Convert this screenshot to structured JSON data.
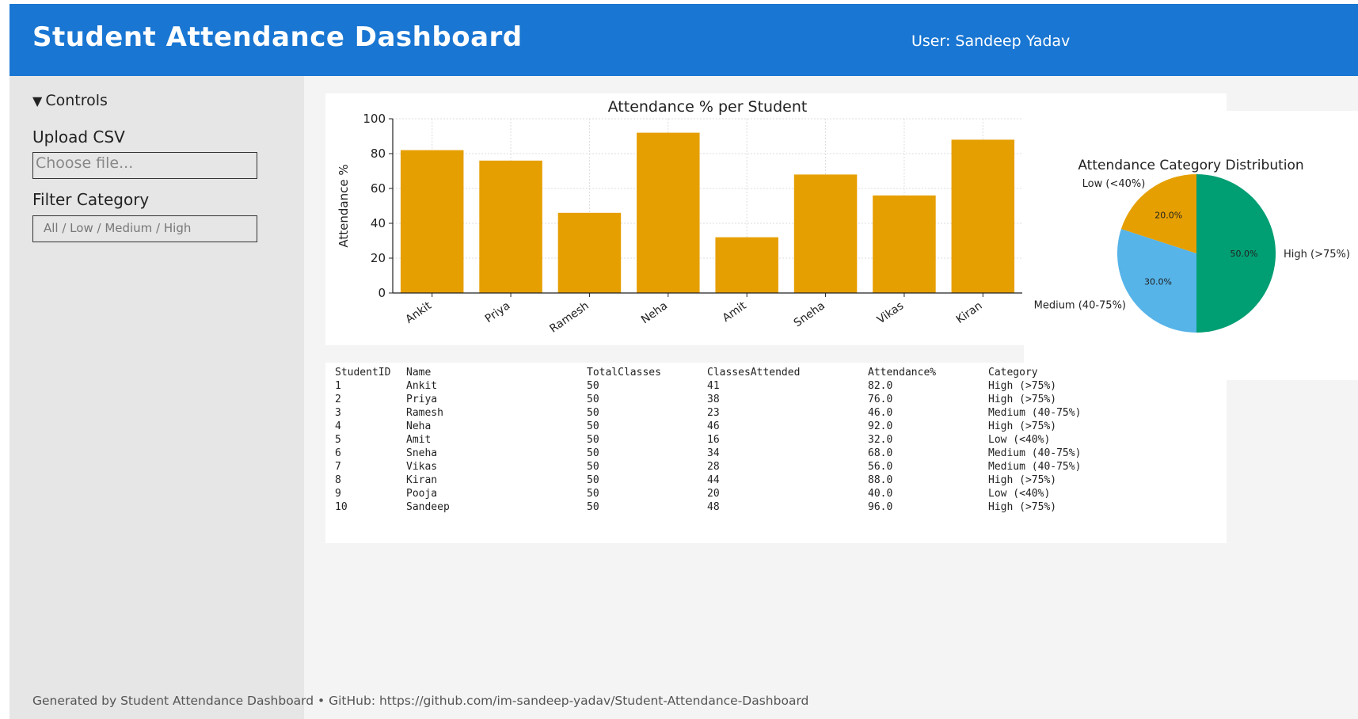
{
  "header": {
    "title": "Student Attendance Dashboard",
    "user": "User: Sandeep Yadav"
  },
  "sidebar": {
    "controls_label": "Controls",
    "upload_label": "Upload CSV",
    "upload_placeholder": "Choose file...",
    "filter_label": "Filter Category",
    "filter_value": "All / Low / Medium / High"
  },
  "colors": {
    "header": "#1976d2",
    "bar": "#e69f00",
    "high": "#009e73",
    "medium": "#56b4e9",
    "low": "#e69f00"
  },
  "chart_data": [
    {
      "type": "bar",
      "title": "Attendance % per Student",
      "xlabel": "",
      "ylabel": "Attendance %",
      "categories": [
        "Ankit",
        "Priya",
        "Ramesh",
        "Neha",
        "Amit",
        "Sneha",
        "Vikas",
        "Kiran"
      ],
      "values": [
        82,
        76,
        46,
        92,
        32,
        68,
        56,
        88
      ],
      "ylim": [
        0,
        100
      ],
      "yticks": [
        0,
        20,
        40,
        60,
        80,
        100
      ],
      "grid": true,
      "legend": "none"
    },
    {
      "type": "pie",
      "title": "Attendance Category Distribution",
      "slices": [
        {
          "label": "High (>75%)",
          "value": 50.0,
          "pct_label": "50.0%",
          "color": "#009e73"
        },
        {
          "label": "Medium (40-75%)",
          "value": 30.0,
          "pct_label": "30.0%",
          "color": "#56b4e9"
        },
        {
          "label": "Low (<40%)",
          "value": 20.0,
          "pct_label": "20.0%",
          "color": "#e69f00"
        }
      ],
      "legend": "none"
    }
  ],
  "table": {
    "columns": [
      "StudentID",
      "Name",
      "TotalClasses",
      "ClassesAttended",
      "Attendance%",
      "Category"
    ],
    "rows": [
      [
        "1",
        "Ankit",
        "50",
        "41",
        "82.0",
        "High (>75%)"
      ],
      [
        "2",
        "Priya",
        "50",
        "38",
        "76.0",
        "High (>75%)"
      ],
      [
        "3",
        "Ramesh",
        "50",
        "23",
        "46.0",
        "Medium (40-75%)"
      ],
      [
        "4",
        "Neha",
        "50",
        "46",
        "92.0",
        "High (>75%)"
      ],
      [
        "5",
        "Amit",
        "50",
        "16",
        "32.0",
        "Low (<40%)"
      ],
      [
        "6",
        "Sneha",
        "50",
        "34",
        "68.0",
        "Medium (40-75%)"
      ],
      [
        "7",
        "Vikas",
        "50",
        "28",
        "56.0",
        "Medium (40-75%)"
      ],
      [
        "8",
        "Kiran",
        "50",
        "44",
        "88.0",
        "High (>75%)"
      ],
      [
        "9",
        "Pooja",
        "50",
        "20",
        "40.0",
        "Low (<40%)"
      ],
      [
        "10",
        "Sandeep",
        "50",
        "48",
        "96.0",
        "High (>75%)"
      ]
    ]
  },
  "footer": {
    "text": "Generated by Student Attendance Dashboard • GitHub: https://github.com/im-sandeep-yadav/Student-Attendance-Dashboard"
  }
}
